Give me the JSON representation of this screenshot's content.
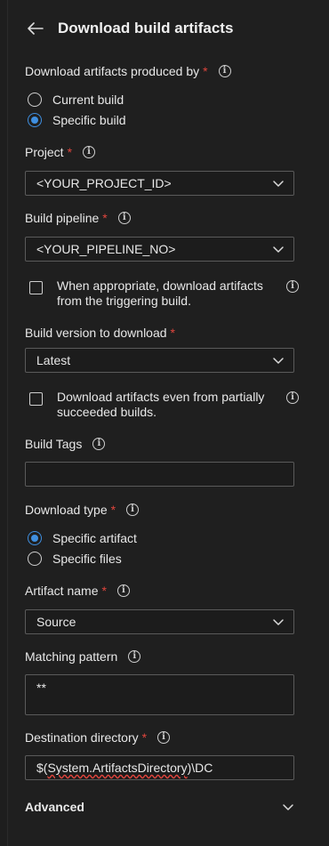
{
  "header": {
    "title": "Download build artifacts"
  },
  "download_from": {
    "label": "Download artifacts produced by",
    "options": [
      "Current build",
      "Specific build"
    ],
    "selected": "Specific build"
  },
  "project": {
    "label": "Project",
    "value": "<YOUR_PROJECT_ID>"
  },
  "pipeline": {
    "label": "Build pipeline",
    "value": "<YOUR_PIPELINE_NO>"
  },
  "triggering_check": {
    "text": "When appropriate, download artifacts from the triggering build.",
    "checked": false
  },
  "build_version": {
    "label": "Build version to download",
    "value": "Latest"
  },
  "partial_check": {
    "text": "Download artifacts even from partially succeeded builds.",
    "checked": false
  },
  "build_tags": {
    "label": "Build Tags",
    "value": ""
  },
  "download_type": {
    "label": "Download type",
    "options": [
      "Specific artifact",
      "Specific files"
    ],
    "selected": "Specific artifact"
  },
  "artifact_name": {
    "label": "Artifact name",
    "value": "Source"
  },
  "matching_pattern": {
    "label": "Matching pattern",
    "value": "**"
  },
  "destination": {
    "label": "Destination directory",
    "prefix": "$(",
    "var": "System.ArtifactsDirectory",
    "suffix": ")\\DC"
  },
  "advanced": {
    "label": "Advanced"
  },
  "colors": {
    "accent": "#3f8fe0",
    "required": "#e0453d",
    "background": "#1f1f1f"
  }
}
